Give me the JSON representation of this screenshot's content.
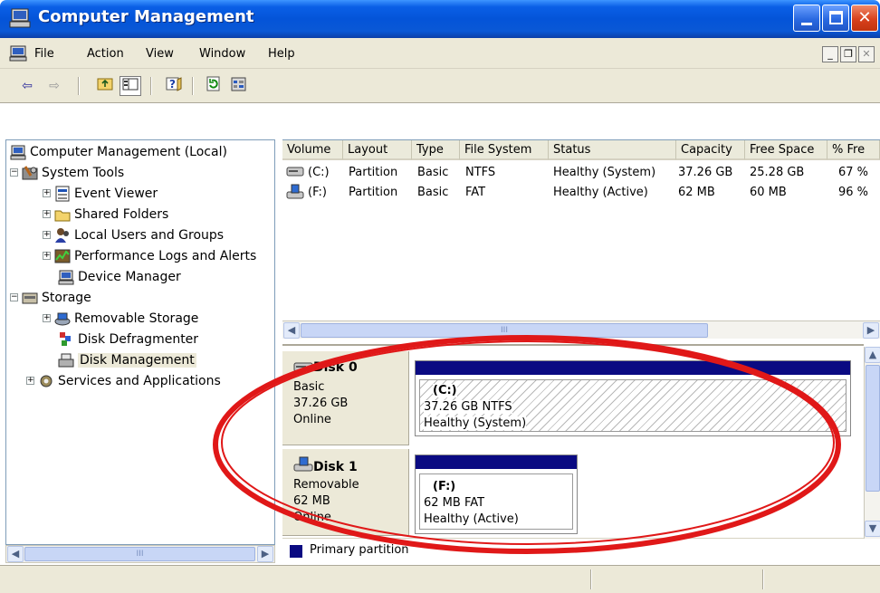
{
  "window": {
    "title": "Computer Management"
  },
  "menu": {
    "items": [
      "File",
      "Action",
      "View",
      "Window",
      "Help"
    ]
  },
  "toolbar": {
    "icons": [
      "back-arrow-icon",
      "forward-arrow-icon",
      "up-folder-icon",
      "show-hide-tree-icon",
      "help-icon",
      "refresh-icon",
      "properties-icon"
    ]
  },
  "tree": {
    "root": "Computer Management (Local)",
    "system_tools": "System Tools",
    "event_viewer": "Event Viewer",
    "shared_folders": "Shared Folders",
    "local_users": "Local Users and Groups",
    "perf_logs": "Performance Logs and Alerts",
    "device_manager": "Device Manager",
    "storage": "Storage",
    "removable_storage": "Removable Storage",
    "disk_defrag": "Disk Defragmenter",
    "disk_management": "Disk Management",
    "services_apps": "Services and Applications",
    "scroll_thumb_text": "III"
  },
  "volume_list": {
    "headers": [
      "Volume",
      "Layout",
      "Type",
      "File System",
      "Status",
      "Capacity",
      "Free Space",
      "% Fre"
    ],
    "rows": [
      {
        "volume": "(C:)",
        "layout": "Partition",
        "type": "Basic",
        "fs": "NTFS",
        "status": "Healthy (System)",
        "capacity": "37.26 GB",
        "free": "25.28 GB",
        "pct": "67 %"
      },
      {
        "volume": "(F:)",
        "layout": "Partition",
        "type": "Basic",
        "fs": "FAT",
        "status": "Healthy (Active)",
        "capacity": "62 MB",
        "free": "60 MB",
        "pct": "96 %"
      }
    ],
    "scroll_thumb_text": "III"
  },
  "disks": {
    "disk0": {
      "name": "Disk 0",
      "kind": "Basic",
      "size": "37.26 GB",
      "state": "Online",
      "partition": {
        "label": "(C:)",
        "info": "37.26 GB NTFS",
        "status": "Healthy (System)"
      }
    },
    "disk1": {
      "name": "Disk 1",
      "kind": "Removable",
      "size": "62 MB",
      "state": "Online",
      "partition": {
        "label": "(F:)",
        "info": "62 MB FAT",
        "status": "Healthy (Active)"
      }
    }
  },
  "legend": {
    "primary_partition": "Primary partition"
  },
  "colors": {
    "accent_blue": "#0a0a82",
    "annotation_red": "#e01818",
    "window_bg": "#ece9d8"
  }
}
